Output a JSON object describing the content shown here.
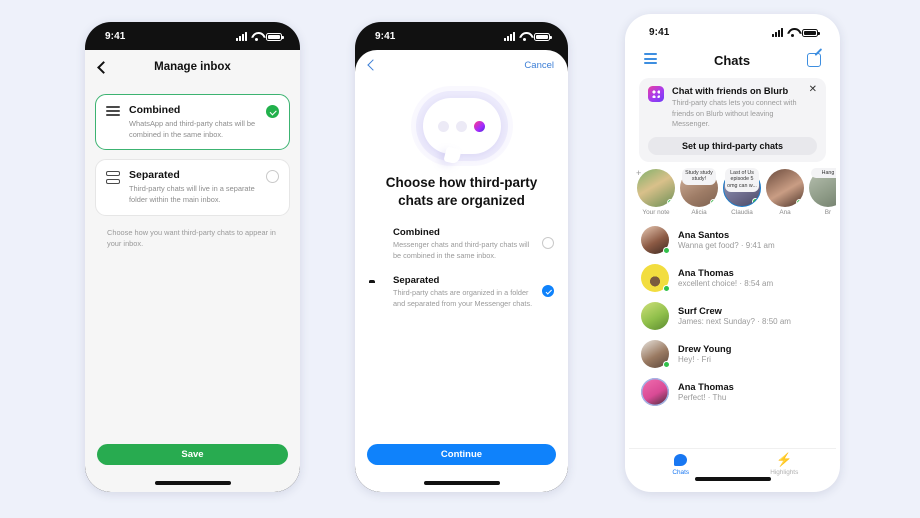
{
  "background_color": "#eef1fa",
  "phone1": {
    "status": {
      "time": "9:41",
      "icons": [
        "signal-icon",
        "wifi-icon",
        "battery-icon"
      ]
    },
    "nav": {
      "back_icon": "chevron-left-icon",
      "title": "Manage inbox"
    },
    "options": [
      {
        "icon": "lines-icon",
        "title": "Combined",
        "desc": "WhatsApp and third-party chats will be combined in the same inbox.",
        "selected": true
      },
      {
        "icon": "stacked-rows-icon",
        "title": "Separated",
        "desc": "Third-party chats will live in a separate folder within the main inbox.",
        "selected": false
      }
    ],
    "footnote": "Choose how you want third-party chats to appear in your inbox.",
    "primary_button": {
      "label": "Save",
      "color": "#28ab50"
    }
  },
  "phone2": {
    "status": {
      "time": "9:41",
      "icons": [
        "signal-icon",
        "wifi-icon",
        "battery-icon"
      ]
    },
    "nav": {
      "back_icon": "chevron-left-icon",
      "cancel_label": "Cancel",
      "accent": "#3d7fd6"
    },
    "illustration": {
      "name": "chat-bubble-illustration",
      "dots": 3,
      "accent": "#a42bff"
    },
    "heading": "Choose how third-party chats are organized",
    "options": [
      {
        "icon": "chat-bubble-icon",
        "title": "Combined",
        "desc": "Messenger chats and third-party chats will be combined in the same inbox.",
        "selected": false
      },
      {
        "icon": "folder-icon",
        "title": "Separated",
        "desc": "Third-party chats are organized in a folder and separated from your Messenger chats.",
        "selected": true
      }
    ],
    "primary_button": {
      "label": "Continue",
      "color": "#0f82fb"
    }
  },
  "phone3": {
    "status": {
      "time": "9:41",
      "icons": [
        "signal-icon",
        "wifi-icon",
        "battery-icon"
      ]
    },
    "nav": {
      "menu_icon": "hamburger-icon",
      "title": "Chats",
      "compose_icon": "compose-icon",
      "accent": "#3d8ee0"
    },
    "banner": {
      "app_icon": "blurb-app-icon",
      "title": "Chat with friends on Blurb",
      "desc": "Third-party chats lets you connect with friends on Blurb without leaving Messenger.",
      "close_icon": "close-icon",
      "cta_label": "Set up third-party chats"
    },
    "stories": [
      {
        "name": "Your note",
        "note": "",
        "add": true,
        "ring": false,
        "online": true
      },
      {
        "name": "Alicia",
        "note": "Study study study!",
        "add": false,
        "ring": false,
        "online": true
      },
      {
        "name": "Claudia",
        "note": "Last of Us episode 5 omg can w...",
        "add": false,
        "ring": true,
        "online": true
      },
      {
        "name": "Ana",
        "note": "",
        "add": false,
        "ring": false,
        "online": true
      },
      {
        "name": "Br",
        "note": "Hang",
        "add": false,
        "ring": false,
        "online": false
      }
    ],
    "chats": [
      {
        "name": "Ana Santos",
        "preview": "Wanna get food? · 9:41 am",
        "online": true
      },
      {
        "name": "Ana Thomas",
        "preview": "excellent choice! · 8:54 am",
        "online": true
      },
      {
        "name": "Surf Crew",
        "preview": "James: next Sunday? · 8:50 am",
        "online": false
      },
      {
        "name": "Drew Young",
        "preview": "Hey! · Fri",
        "online": true
      },
      {
        "name": "Ana Thomas",
        "preview": "Perfect! · Thu",
        "online": false
      }
    ],
    "tabs": [
      {
        "label": "Chats",
        "icon": "chat-bubble-icon",
        "active": true
      },
      {
        "label": "Highlights",
        "icon": "bolt-icon",
        "active": false
      }
    ]
  }
}
